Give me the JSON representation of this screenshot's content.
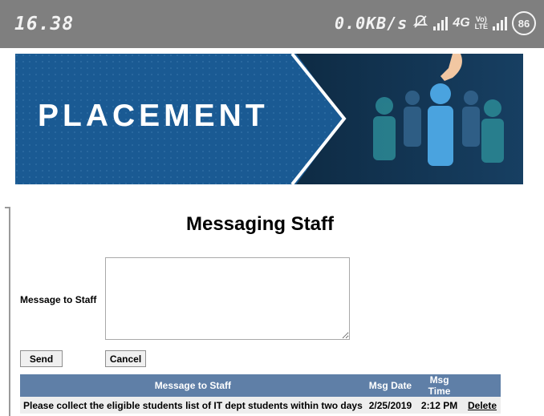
{
  "status_bar": {
    "time": "16.38",
    "network_speed": "0.0KB/s",
    "network_type": "4G",
    "volte_line1": "Vo)",
    "volte_line2": "LTE",
    "battery": "86"
  },
  "banner": {
    "title": "PLACEMENT"
  },
  "page": {
    "title": "Messaging Staff"
  },
  "form": {
    "message_label": "Message to Staff",
    "message_value": "",
    "send_label": "Send",
    "cancel_label": "Cancel"
  },
  "table": {
    "headers": [
      "Message to Staff",
      "Msg Date",
      "Msg Time",
      ""
    ],
    "rows": [
      {
        "message": "Please collect the eligible students list of IT dept students within two days",
        "date": "2/25/2019",
        "time": "2:12 PM",
        "action": "Delete"
      }
    ]
  },
  "colors": {
    "status_bar": "#7f7f7f",
    "banner_blue": "#154a7a",
    "table_header": "#5f7fa7",
    "row_bg": "#eeeeee"
  }
}
